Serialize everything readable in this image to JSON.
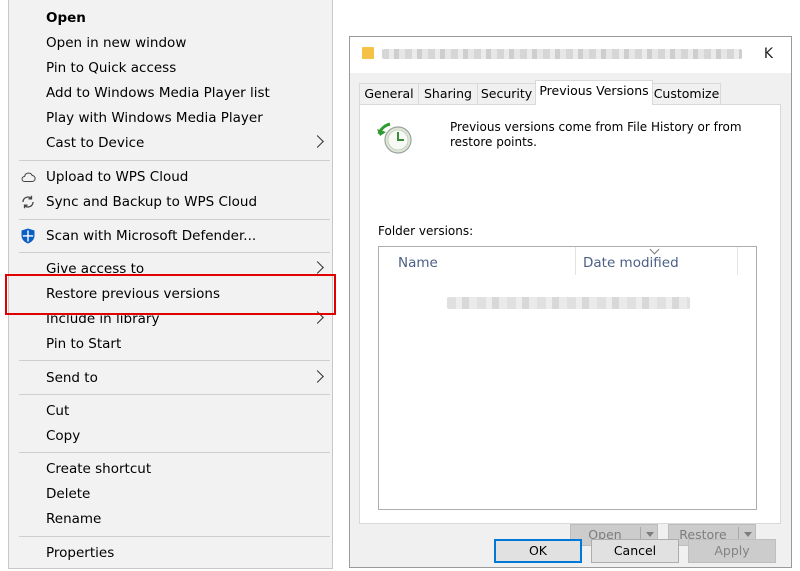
{
  "context_menu": {
    "items": [
      {
        "label": "Open",
        "bold": true
      },
      {
        "label": "Open in new window"
      },
      {
        "label": "Pin to Quick access"
      },
      {
        "label": "Add to Windows Media Player list"
      },
      {
        "label": "Play with Windows Media Player"
      },
      {
        "label": "Cast to Device",
        "submenu": true
      },
      {
        "label": "Upload to WPS Cloud",
        "icon": "cloud-icon"
      },
      {
        "label": "Sync and Backup to WPS Cloud",
        "icon": "sync-icon"
      },
      {
        "label": "Scan with Microsoft Defender...",
        "icon": "defender-shield-icon"
      },
      {
        "label": "Give access to",
        "submenu": true
      },
      {
        "label": "Restore previous versions",
        "highlighted": true
      },
      {
        "label": "Include in library",
        "submenu": true
      },
      {
        "label": "Pin to Start"
      },
      {
        "label": "Send to",
        "submenu": true
      },
      {
        "label": "Cut"
      },
      {
        "label": "Copy"
      },
      {
        "label": "Create shortcut"
      },
      {
        "label": "Delete"
      },
      {
        "label": "Rename"
      },
      {
        "label": "Properties"
      }
    ],
    "highlight_color": "#e00000"
  },
  "dialog": {
    "close_label": "K",
    "tabs": [
      {
        "label": "General"
      },
      {
        "label": "Sharing"
      },
      {
        "label": "Security"
      },
      {
        "label": "Previous Versions",
        "active": true
      },
      {
        "label": "Customize"
      }
    ],
    "intro_text": "Previous versions come from File History or from restore points.",
    "folder_versions_label": "Folder versions:",
    "columns": {
      "name": "Name",
      "date_modified": "Date modified"
    },
    "open_button": "Open",
    "restore_button": "Restore",
    "ok_button": "OK",
    "cancel_button": "Cancel",
    "apply_button": "Apply",
    "accent_color": "#0078d7"
  }
}
